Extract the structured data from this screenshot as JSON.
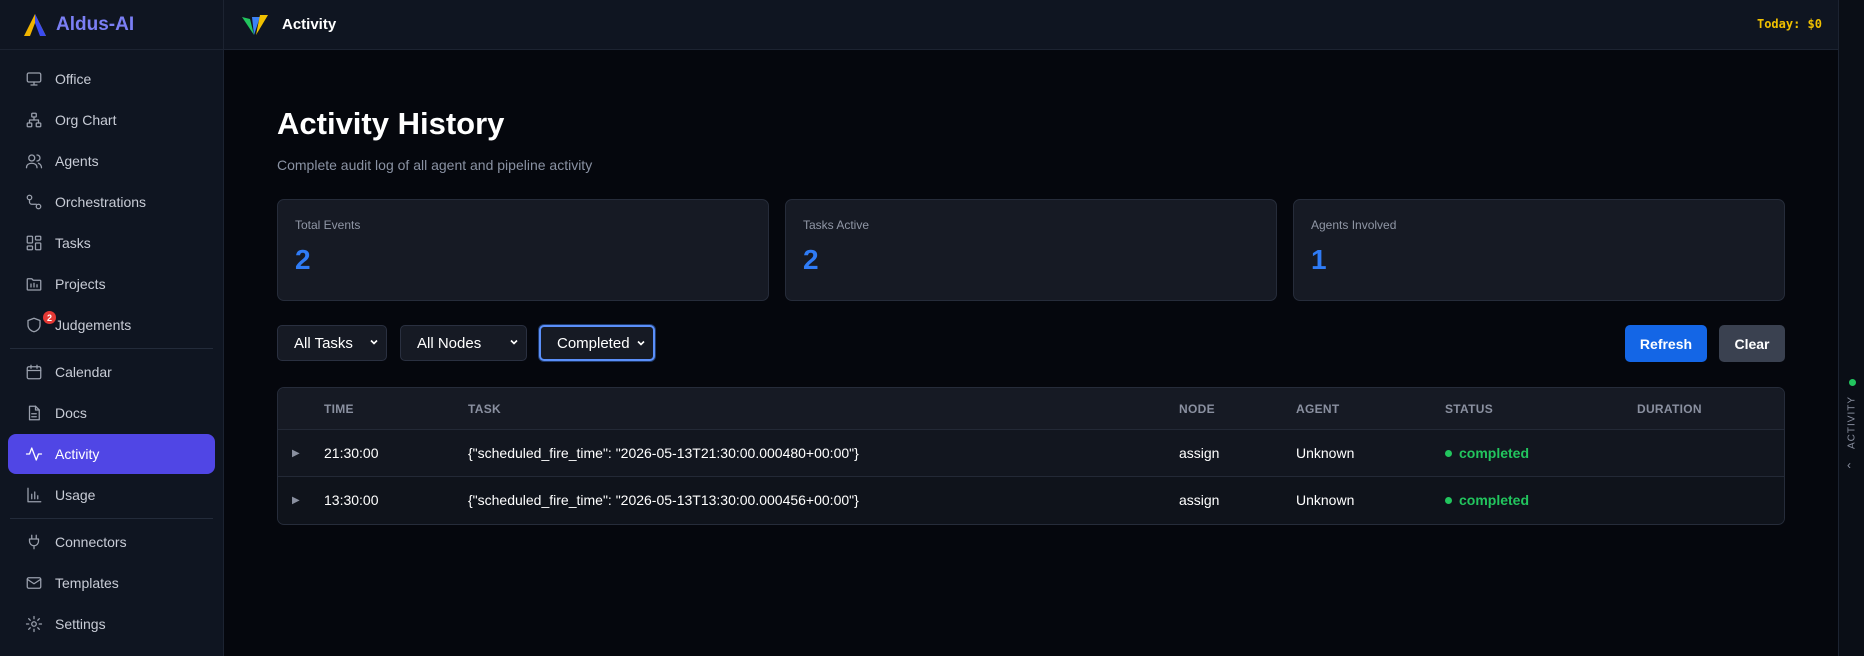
{
  "app": {
    "name": "Aldus-AI"
  },
  "sidebar": {
    "items": [
      {
        "label": "Office",
        "icon": "monitor-icon"
      },
      {
        "label": "Org Chart",
        "icon": "org-chart-icon"
      },
      {
        "label": "Agents",
        "icon": "users-icon"
      },
      {
        "label": "Orchestrations",
        "icon": "workflow-icon"
      },
      {
        "label": "Tasks",
        "icon": "grid-icon"
      },
      {
        "label": "Projects",
        "icon": "folder-icon"
      },
      {
        "label": "Judgements",
        "icon": "shield-icon",
        "badge": "2"
      },
      {
        "label": "Calendar",
        "icon": "calendar-icon"
      },
      {
        "label": "Docs",
        "icon": "document-icon"
      },
      {
        "label": "Activity",
        "icon": "activity-icon",
        "active": true
      },
      {
        "label": "Usage",
        "icon": "bar-chart-icon"
      },
      {
        "label": "Connectors",
        "icon": "plug-icon"
      },
      {
        "label": "Templates",
        "icon": "mail-icon"
      },
      {
        "label": "Settings",
        "icon": "gear-icon"
      }
    ]
  },
  "header": {
    "title": "Activity",
    "today": "Today: $0"
  },
  "right_rail": {
    "label": "ACTIVITY",
    "status_color": "#22c55e"
  },
  "main": {
    "title": "Activity History",
    "subtitle": "Complete audit log of all agent and pipeline activity",
    "stats": [
      {
        "label": "Total Events",
        "value": "2"
      },
      {
        "label": "Tasks Active",
        "value": "2"
      },
      {
        "label": "Agents Involved",
        "value": "1"
      }
    ],
    "filters": {
      "tasks": "All Tasks",
      "nodes": "All Nodes",
      "status": "Completed"
    },
    "buttons": {
      "refresh": "Refresh",
      "clear": "Clear"
    },
    "table": {
      "columns": [
        "TIME",
        "TASK",
        "NODE",
        "AGENT",
        "STATUS",
        "DURATION"
      ],
      "rows": [
        {
          "time": "21:30:00",
          "task": "{\"scheduled_fire_time\": \"2026-05-13T21:30:00.000480+00:00\"}",
          "node": "assign",
          "agent": "Unknown",
          "status": "completed",
          "duration": ""
        },
        {
          "time": "13:30:00",
          "task": "{\"scheduled_fire_time\": \"2026-05-13T13:30:00.000456+00:00\"}",
          "node": "assign",
          "agent": "Unknown",
          "status": "completed",
          "duration": ""
        }
      ]
    }
  },
  "colors": {
    "accent": "#5046e5",
    "primary_button": "#1466e6",
    "stat_value": "#2f7bf5",
    "success": "#22c55e",
    "today": "#f0c000"
  }
}
